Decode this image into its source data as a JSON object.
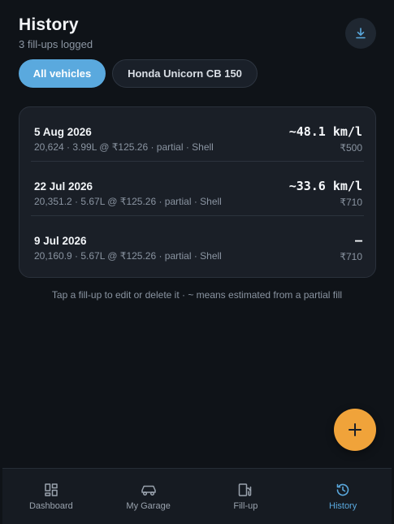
{
  "header": {
    "title": "History",
    "subtitle": "3 fill-ups logged"
  },
  "filters": {
    "all": "All vehicles",
    "vehicle": "Honda Unicorn CB 150"
  },
  "entries": [
    {
      "date": "5 Aug 2026",
      "detail": "20,624 · 3.99L @ ₹125.26 · partial · Shell",
      "efficiency": "~48.1 km/l",
      "cost": "₹500"
    },
    {
      "date": "22 Jul 2026",
      "detail": "20,351.2 · 5.67L @ ₹125.26 · partial · Shell",
      "efficiency": "~33.6 km/l",
      "cost": "₹710"
    },
    {
      "date": "9 Jul 2026",
      "detail": "20,160.9 · 5.67L @ ₹125.26 · partial · Shell",
      "efficiency": "–",
      "cost": "₹710"
    }
  ],
  "hint": "Tap a fill-up to edit or delete it · ~ means estimated from a partial fill",
  "nav": {
    "dashboard": "Dashboard",
    "garage": "My Garage",
    "fillup": "Fill-up",
    "history": "History"
  },
  "colors": {
    "accent": "#5aa9de",
    "fab": "#f0a33a",
    "background": "#0f1318",
    "card": "#1a1f27"
  },
  "icons": {
    "download": "download-icon",
    "add": "plus-icon",
    "dashboard": "dashboard-icon",
    "garage": "car-icon",
    "fillup": "fuel-pump-icon",
    "history": "history-icon"
  }
}
